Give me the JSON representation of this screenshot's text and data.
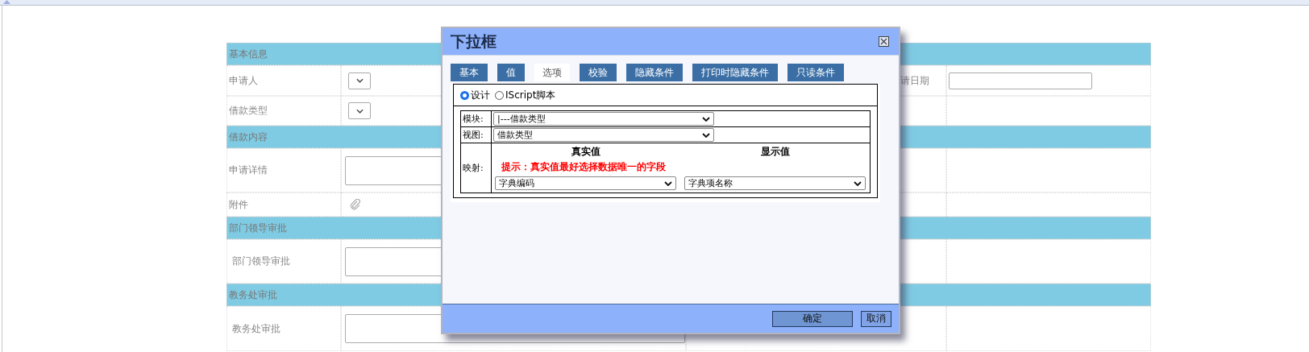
{
  "form": {
    "sections": [
      {
        "title": "基本信息",
        "rows": [
          {
            "label": "申请人",
            "field": {
              "kind": "select"
            },
            "label2": "请日期",
            "field2": {
              "kind": "input"
            }
          },
          {
            "label": "借款类型",
            "field": {
              "kind": "select"
            }
          }
        ]
      },
      {
        "title": "借款内容",
        "rows": [
          {
            "label": "申请详情",
            "field": {
              "kind": "textarea"
            }
          },
          {
            "label": "附件",
            "field": {
              "kind": "attachment"
            }
          }
        ]
      },
      {
        "title": "部门领导审批",
        "rows": [
          {
            "label": "部门领导审批",
            "field": {
              "kind": "textarea"
            }
          }
        ]
      },
      {
        "title": "教务处审批",
        "rows": [
          {
            "label": "教务处审批",
            "field": {
              "kind": "textarea"
            }
          }
        ]
      }
    ]
  },
  "dialog": {
    "title": "下拉框",
    "tabs": [
      {
        "label": "基本",
        "selected": false
      },
      {
        "label": "值",
        "selected": false
      },
      {
        "label": "选项",
        "selected": true
      },
      {
        "label": "校验",
        "selected": false
      },
      {
        "label": "隐藏条件",
        "selected": false
      },
      {
        "label": "打印时隐藏条件",
        "selected": false
      },
      {
        "label": "只读条件",
        "selected": false
      }
    ],
    "source_options": [
      {
        "label": "设计",
        "selected": true
      },
      {
        "label": "IScript脚本",
        "selected": false
      }
    ],
    "module": {
      "label": "模块:",
      "value": "|---借款类型"
    },
    "view": {
      "label": "视图:",
      "value": "借款类型"
    },
    "mapping": {
      "label": "映射:",
      "real_header": "真实值",
      "display_header": "显示值",
      "hint": "提示：真实值最好选择数据唯一的字段",
      "real_value": "字典编码",
      "display_value": "字典项名称"
    },
    "buttons": [
      {
        "label": "确定",
        "kind": "primary"
      },
      {
        "label": "取消",
        "kind": "secondary"
      }
    ]
  }
}
